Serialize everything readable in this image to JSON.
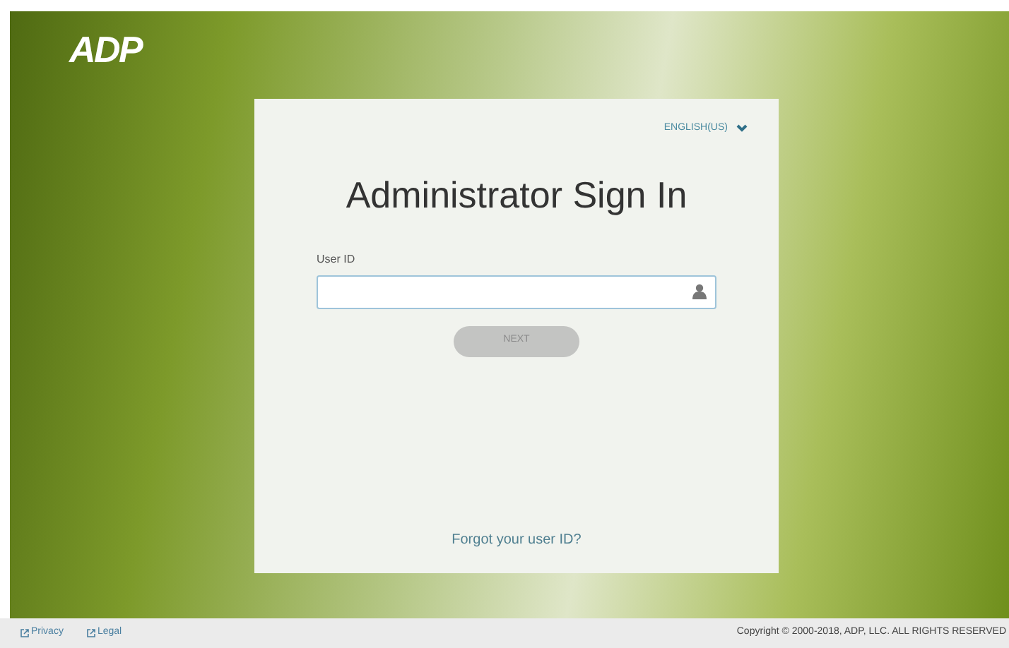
{
  "logo": "ADP",
  "language": {
    "label": "ENGLISH(US)"
  },
  "card": {
    "title": "Administrator Sign In",
    "user_id": {
      "label": "User ID"
    },
    "next_button": {
      "label": "NEXT",
      "disabled": true
    },
    "forgot_link": "Forgot your user ID?"
  },
  "footer": {
    "links": [
      "Privacy",
      "Legal"
    ],
    "copyright": "Copyright © 2000-2018, ADP, LLC. ALL RIGHTS RESERVED"
  }
}
